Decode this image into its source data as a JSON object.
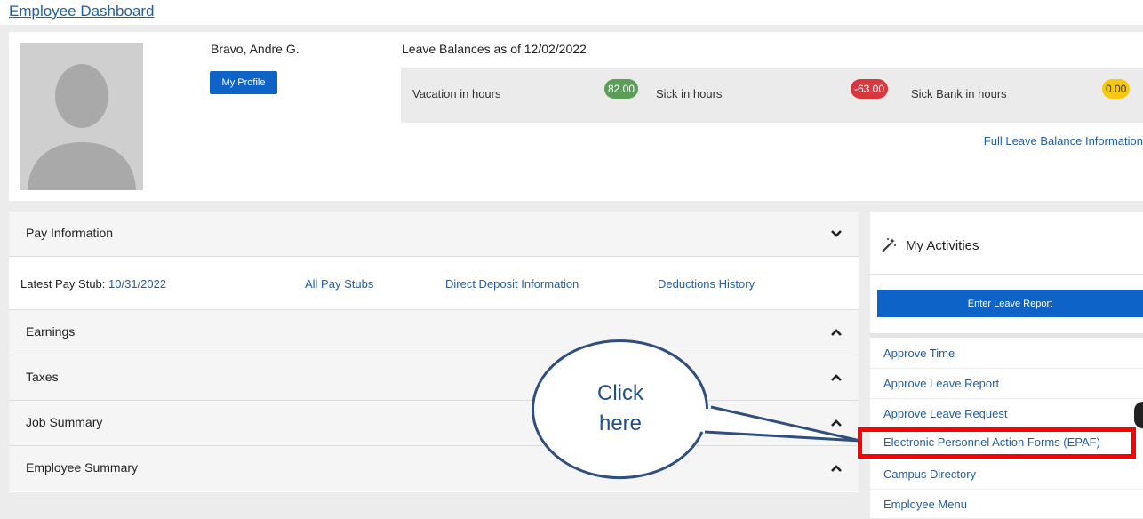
{
  "breadcrumb": "Employee Dashboard",
  "profile": {
    "name": "Bravo, Andre G.",
    "my_profile_label": "My Profile"
  },
  "leave": {
    "title": "Leave Balances as of 12/02/2022",
    "items": [
      {
        "label": "Vacation in hours",
        "value": "82.00",
        "color": "#5a9e5a"
      },
      {
        "label": "Sick in hours",
        "value": "-63.00",
        "color": "#d9363e"
      },
      {
        "label": "Sick Bank in hours",
        "value": "0.00",
        "color": "#f6c90e"
      }
    ],
    "full_link": "Full Leave Balance Information"
  },
  "pay": {
    "header": "Pay Information",
    "latest_label": "Latest Pay Stub:",
    "latest_date": "10/31/2022",
    "links": [
      "All Pay Stubs",
      "Direct Deposit Information",
      "Deductions History"
    ],
    "sections": [
      "Earnings",
      "Taxes",
      "Job Summary",
      "Employee Summary"
    ]
  },
  "activities": {
    "header": "My Activities",
    "enter_button": "Enter Leave Report",
    "items": [
      "Approve Time",
      "Approve Leave Report",
      "Approve Leave Request",
      "Electronic Personnel Action Forms (EPAF)",
      "Campus Directory",
      "Employee Menu"
    ]
  },
  "callout": {
    "line1": "Click",
    "line2": "here"
  },
  "colors": {
    "link": "#1f5fa8",
    "primary_button": "#0d63c7",
    "highlight": "#ff0000",
    "callout_stroke": "#2f4f7f"
  }
}
